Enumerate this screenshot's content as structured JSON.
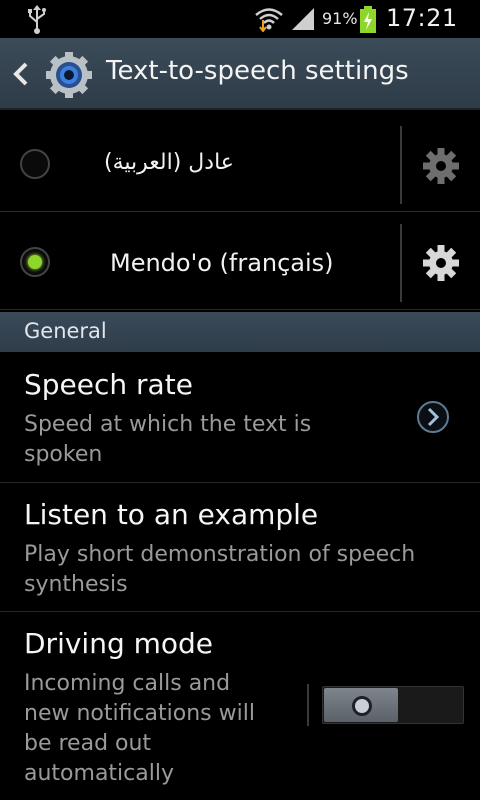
{
  "status_bar": {
    "battery_percent": "91%",
    "time": "17:21"
  },
  "action_bar": {
    "title": "Text-to-speech settings"
  },
  "voices": [
    {
      "label": "عادل (العربية)",
      "selected": false
    },
    {
      "label": "Mendo'o (français)",
      "selected": true
    }
  ],
  "section": {
    "general": "General"
  },
  "prefs": {
    "speech_rate": {
      "title": "Speech rate",
      "summary_line1": "Speed at which the text is",
      "summary_line2": "spoken"
    },
    "listen_example": {
      "title": "Listen to an example",
      "summary_line1": "Play short demonstration of speech",
      "summary_line2": "synthesis"
    },
    "driving_mode": {
      "title": "Driving mode",
      "summary_line1": "Incoming calls and",
      "summary_line2": "new notifications will",
      "summary_line3": "be read out",
      "summary_line4": "automatically",
      "enabled": false
    }
  },
  "colors": {
    "accent_green": "#8fd62b",
    "actionbar": "#2e3c48",
    "background": "#000000"
  },
  "icons": {
    "status": [
      "usb-icon",
      "wifi-icon",
      "signal-icon",
      "battery-charging-icon"
    ],
    "actions": [
      "back-chevron-icon",
      "settings-gear-icon",
      "gear-icon",
      "chevron-right-icon"
    ]
  }
}
